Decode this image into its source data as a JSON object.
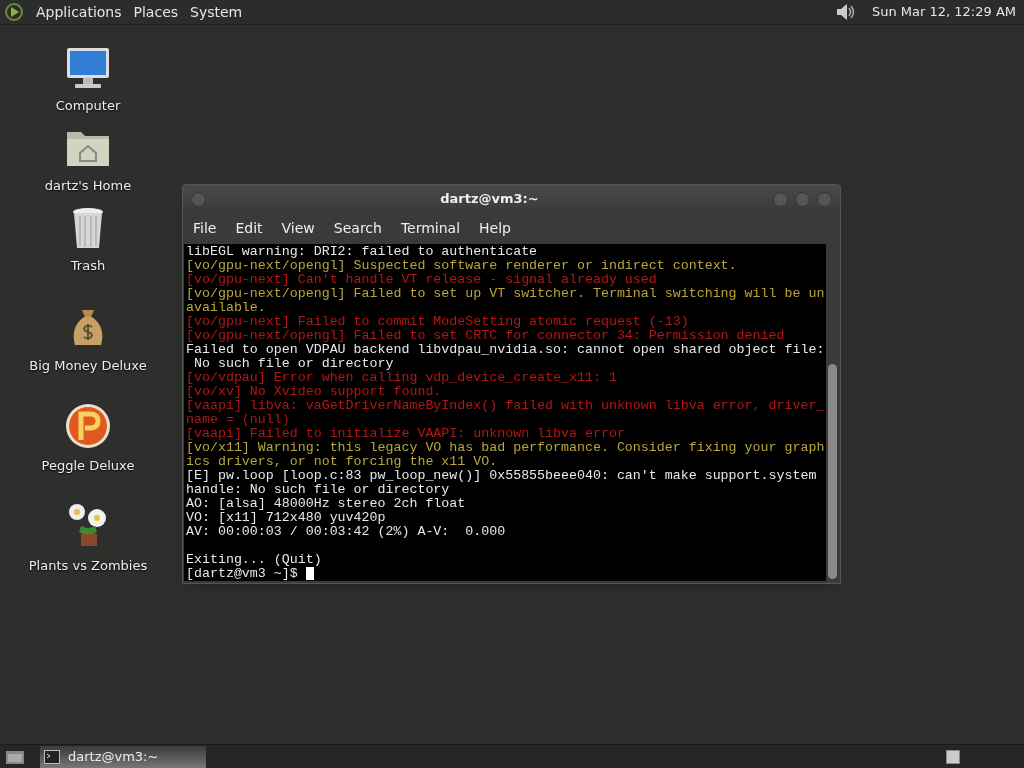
{
  "top_panel": {
    "menus": [
      "Applications",
      "Places",
      "System"
    ],
    "clock": "Sun Mar 12, 12:29 AM"
  },
  "desktop_icons": [
    {
      "label": "Computer",
      "kind": "computer"
    },
    {
      "label": "dartz's Home",
      "kind": "folder"
    },
    {
      "label": "Trash",
      "kind": "trash"
    },
    {
      "label": "Big Money Deluxe",
      "kind": "moneybag"
    },
    {
      "label": "Peggle Deluxe",
      "kind": "ball"
    },
    {
      "label": "Plants vs Zombies",
      "kind": "flower"
    }
  ],
  "window": {
    "title": "dartz@vm3:~",
    "menu": [
      "File",
      "Edit",
      "View",
      "Search",
      "Terminal",
      "Help"
    ],
    "lines": [
      {
        "text": "libEGL warning: DRI2: failed to authenticate",
        "kind": "normal"
      },
      {
        "text": "[vo/gpu-next/opengl] Suspected software renderer or indirect context.",
        "kind": "warn"
      },
      {
        "text": "[vo/gpu-next] Can't handle VT release - signal already used",
        "kind": "error"
      },
      {
        "text": "[vo/gpu-next/opengl] Failed to set up VT switcher. Terminal switching will be un",
        "kind": "warn"
      },
      {
        "text": "available.",
        "kind": "warn"
      },
      {
        "text": "[vo/gpu-next] Failed to commit ModeSetting atomic request (-13)",
        "kind": "error"
      },
      {
        "text": "[vo/gpu-next/opengl] Failed to set CRTC for connector 34: Permission denied",
        "kind": "error"
      },
      {
        "text": "Failed to open VDPAU backend libvdpau_nvidia.so: cannot open shared object file:",
        "kind": "normal"
      },
      {
        "text": " No such file or directory",
        "kind": "normal"
      },
      {
        "text": "[vo/vdpau] Error when calling vdp_device_create_x11: 1",
        "kind": "error"
      },
      {
        "text": "[vo/xv] No Xvideo support found.",
        "kind": "error"
      },
      {
        "text": "[vaapi] libva: vaGetDriverNameByIndex() failed with unknown libva error, driver_",
        "kind": "error"
      },
      {
        "text": "name = (null)",
        "kind": "error"
      },
      {
        "text": "[vaapi] Failed to initialize VAAPI: unknown libva error",
        "kind": "error"
      },
      {
        "text": "[vo/x11] Warning: this legacy VO has bad performance. Consider fixing your graph",
        "kind": "warn"
      },
      {
        "text": "ics drivers, or not forcing the x11 VO.",
        "kind": "warn"
      },
      {
        "text": "[E] pw.loop [loop.c:83 pw_loop_new()] 0x55855beee040: can't make support.system",
        "kind": "normal"
      },
      {
        "text": "handle: No such file or directory",
        "kind": "normal"
      },
      {
        "text": "AO: [alsa] 48000Hz stereo 2ch float",
        "kind": "normal"
      },
      {
        "text": "VO: [x11] 712x480 yuv420p",
        "kind": "normal"
      },
      {
        "text": "AV: 00:00:03 / 00:03:42 (2%) A-V:  0.000",
        "kind": "normal"
      },
      {
        "kind": "blank"
      },
      {
        "text": "Exiting... (Quit)",
        "kind": "normal"
      }
    ],
    "prompt": "[dartz@vm3 ~]$ "
  },
  "taskbar": {
    "tasks": [
      {
        "label": "dartz@vm3:~",
        "selected": true
      }
    ]
  }
}
